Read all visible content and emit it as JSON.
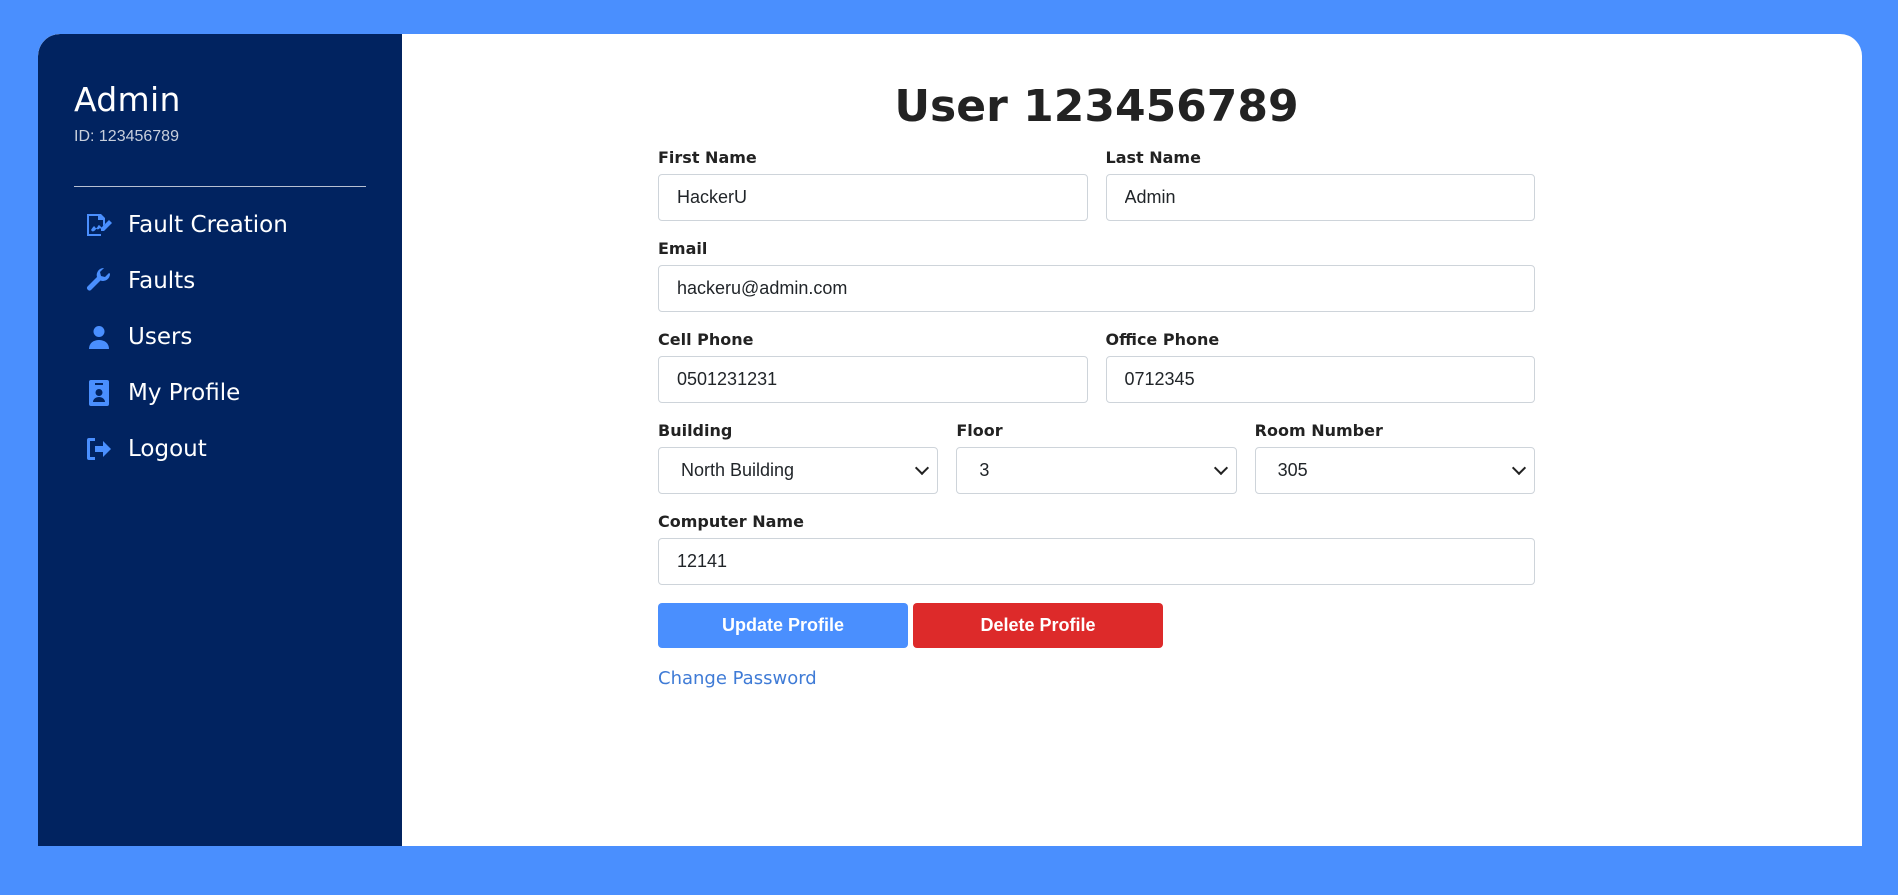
{
  "colors": {
    "background": "#4a8ffe",
    "sidebar": "#012360",
    "accent": "#4a8ffe",
    "danger": "#dd2a2a",
    "link": "#3f7bd6"
  },
  "sidebar": {
    "name": "Admin",
    "id_text": "ID: 123456789",
    "items": [
      {
        "label": "Fault Creation",
        "icon": "file-signature-icon"
      },
      {
        "label": "Faults",
        "icon": "wrench-icon"
      },
      {
        "label": "Users",
        "icon": "user-icon"
      },
      {
        "label": "My Profile",
        "icon": "id-badge-icon"
      },
      {
        "label": "Logout",
        "icon": "sign-out-icon"
      }
    ]
  },
  "form": {
    "title": "User 123456789",
    "first_name": {
      "label": "First Name",
      "value": "HackerU"
    },
    "last_name": {
      "label": "Last Name",
      "value": "Admin"
    },
    "email": {
      "label": "Email",
      "value": "hackeru@admin.com"
    },
    "cell_phone": {
      "label": "Cell Phone",
      "value": "0501231231"
    },
    "office_phone": {
      "label": "Office Phone",
      "value": "0712345"
    },
    "building": {
      "label": "Building",
      "value": "North Building"
    },
    "floor": {
      "label": "Floor",
      "value": "3"
    },
    "room_number": {
      "label": "Room Number",
      "value": "305"
    },
    "computer_name": {
      "label": "Computer Name",
      "value": "12141"
    },
    "update_button": "Update Profile",
    "delete_button": "Delete Profile",
    "change_password": "Change Password"
  }
}
